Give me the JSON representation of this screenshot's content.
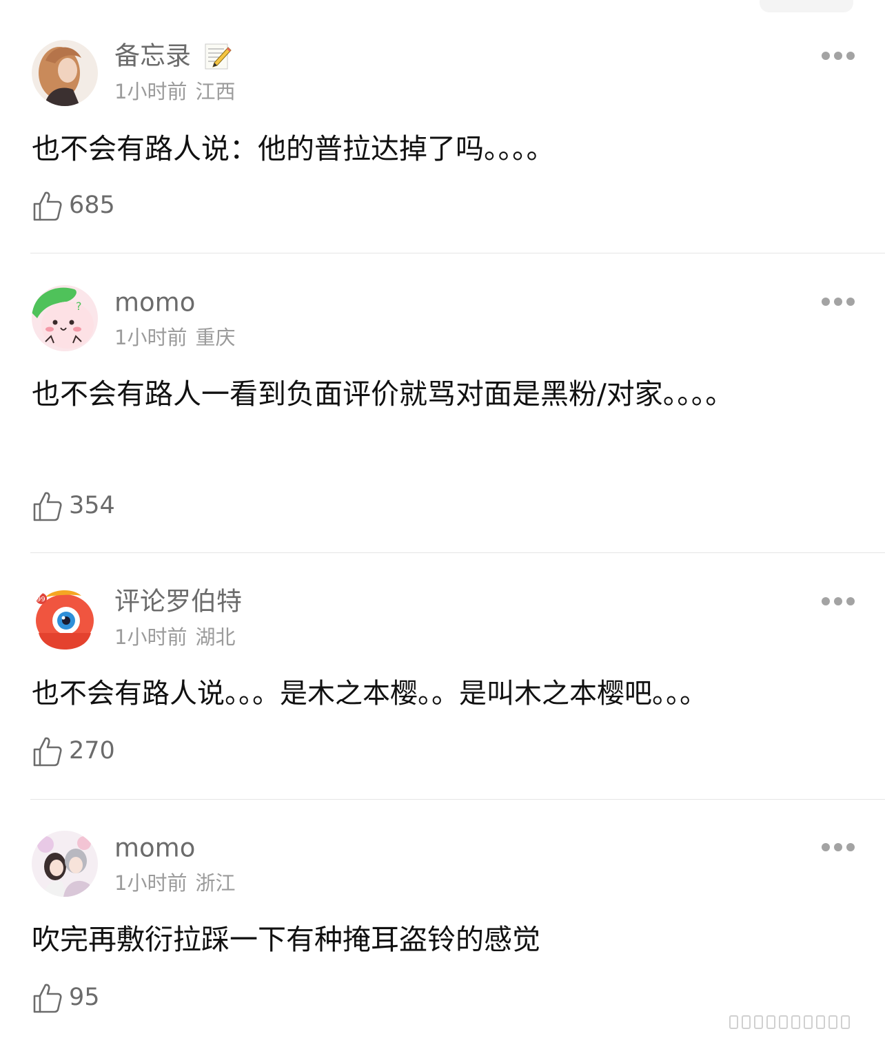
{
  "comments": [
    {
      "username": "备忘录",
      "time": "1小时前",
      "location": "江西",
      "text": "也不会有路人说：他的普拉达掉了吗。。。。",
      "likes": "685"
    },
    {
      "username": "momo",
      "time": "1小时前",
      "location": "重庆",
      "text": "也不会有路人一看到负面评价就骂对面是黑粉/对家。。。。",
      "likes": "354"
    },
    {
      "username": "评论罗伯特",
      "time": "1小时前",
      "location": "湖北",
      "text": "也不会有路人说。。。是木之本樱。。是叫木之本樱吧。。。",
      "likes": "270"
    },
    {
      "username": "momo",
      "time": "1小时前",
      "location": "浙江",
      "text": "吹完再敷衍拉踩一下有种掩耳盗铃的感觉",
      "likes": "95"
    }
  ],
  "icons": {
    "more": "more-icon",
    "like": "thumbs-up-icon",
    "memo": "memo-pencil-icon"
  },
  "colors": {
    "username": "#6b6b6b",
    "meta": "#9b9b9b",
    "body": "#111111",
    "divider": "#e5e5e5"
  }
}
